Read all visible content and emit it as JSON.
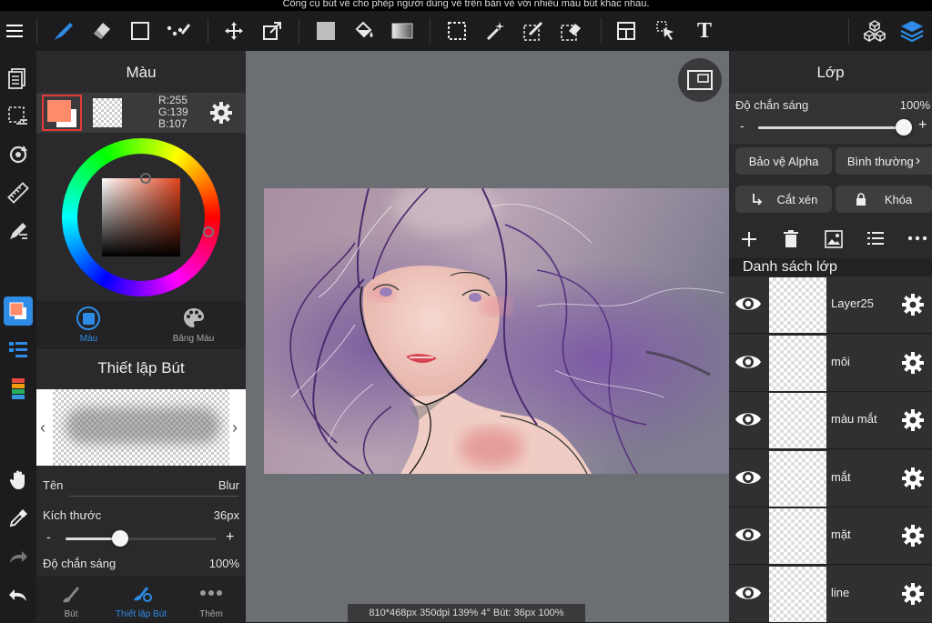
{
  "caption": "Công cụ bút vẽ cho phép người dùng vẽ trên bản vẽ với nhiều màu bút khác nhau.",
  "colors": {
    "accent": "#2e8ce6",
    "fg_color": "#ff8b6b",
    "panel": "#2a2a2c"
  },
  "toolbar": {
    "icons": [
      "menu-icon",
      "pen-icon",
      "eraser-icon",
      "rectangle-icon",
      "select-pen-icon",
      "move-icon",
      "transform-icon",
      "fill-color-icon",
      "bucket-icon",
      "gradient-icon",
      "marquee-icon",
      "magic-wand-icon",
      "select-brush-icon",
      "select-eraser-icon",
      "layout-icon",
      "pointer-icon",
      "text-icon",
      "3d-material-icon",
      "layers-icon"
    ],
    "text_tool": "T"
  },
  "color_panel": {
    "title": "Màu",
    "rgb": {
      "r": "R:255",
      "g": "G:139",
      "b": "B:107"
    },
    "tab_color": "Màu",
    "tab_palette": "Bảng Màu"
  },
  "brush_panel": {
    "title": "Thiết lập Bút",
    "name_label": "Tên",
    "name_value": "Blur",
    "size_label": "Kích thước",
    "size_value": "36px",
    "size_minus": "-",
    "size_plus": "+",
    "size_fraction": 0.36,
    "opacity_label": "Độ chắn sáng",
    "opacity_value": "100%"
  },
  "bottom_tabs": {
    "pen": "Bút",
    "brush_settings": "Thiết lập Bút",
    "more": "Thêm"
  },
  "status_bar": "810*468px 350dpi 139% 4° Bút: 36px 100%",
  "layers_panel": {
    "title": "Lớp",
    "opacity_label": "Độ chắn sáng",
    "opacity_value": "100%",
    "opacity_fraction": 1.0,
    "minus": "-",
    "plus": "+",
    "alpha_protect": "Bảo vệ Alpha",
    "blend_mode": "Bình thường",
    "clipping": "Cắt xén",
    "lock": "Khóa",
    "list_title": "Danh sách lớp",
    "layers": [
      {
        "name": "Layer25"
      },
      {
        "name": "môi"
      },
      {
        "name": "màu mắt"
      },
      {
        "name": "mắt"
      },
      {
        "name": "mặt"
      },
      {
        "name": "line"
      }
    ]
  }
}
